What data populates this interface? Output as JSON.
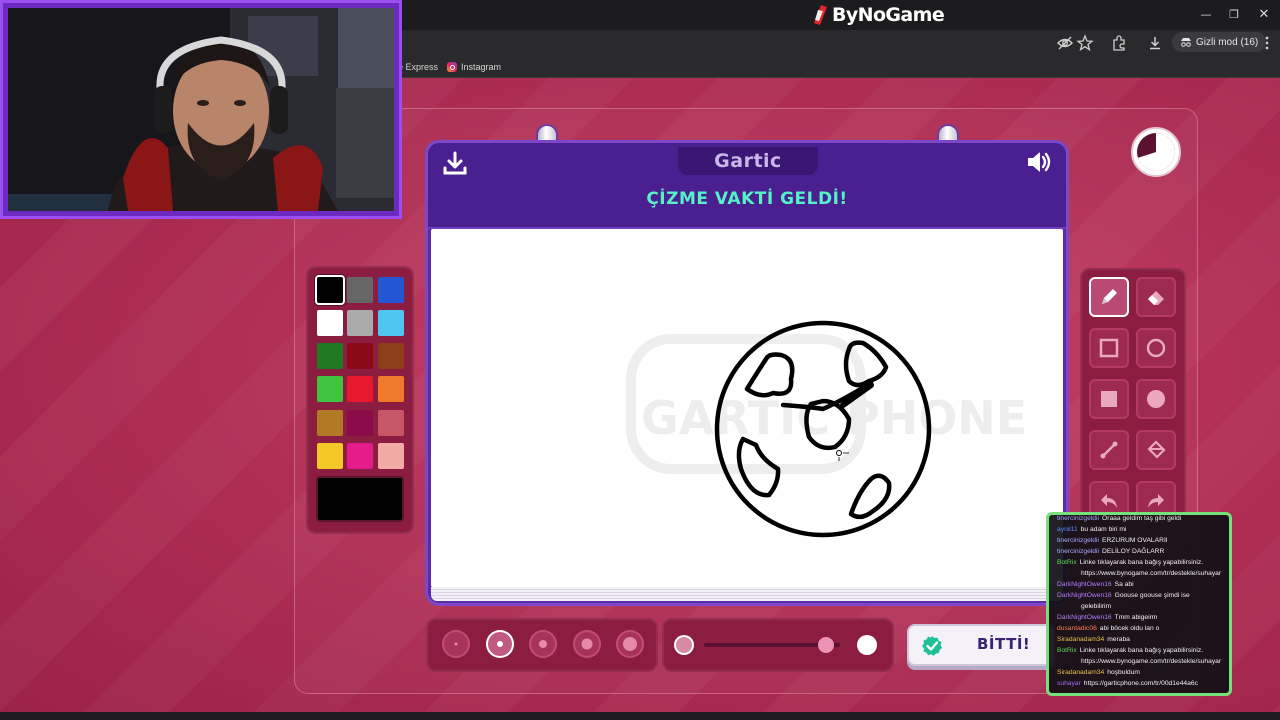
{
  "browser": {
    "brand": "ByNoGame",
    "incognito_label": "Gizli mod (16)",
    "bookmarks": [
      {
        "label": "e Express"
      },
      {
        "label": "Instagram"
      }
    ],
    "window_controls": [
      "minimize-icon",
      "restore-icon",
      "close-icon"
    ]
  },
  "game": {
    "logo": "Gartic",
    "headline": "ÇİZME VAKTİ GELDİ!",
    "done_label": "BİTTİ!",
    "watermark": "GARTIC PHONE",
    "timer_remaining_fraction": 0.7,
    "colors": [
      "#000000",
      "#666666",
      "#2457d6",
      "#ffffff",
      "#aaaaaa",
      "#4fc6f2",
      "#1f7a22",
      "#8a0a1a",
      "#8c3f16",
      "#3ec43e",
      "#e8192c",
      "#ef7a2c",
      "#b27a24",
      "#8a0a4a",
      "#c65767",
      "#f5c82a",
      "#e41c8a",
      "#f2aaa4"
    ],
    "selected_color": "#000000",
    "tools": [
      "pencil-icon",
      "eraser-icon",
      "rectangle-outline-icon",
      "ellipse-outline-icon",
      "rectangle-filled-icon",
      "ellipse-filled-icon",
      "line-icon",
      "fill-bucket-icon",
      "undo-icon",
      "redo-icon"
    ],
    "selected_tool": "pencil-icon",
    "brush_sizes": [
      1,
      2,
      3,
      4,
      5
    ],
    "selected_brush_size": 2,
    "opacity_level": 0.9
  },
  "chat": {
    "accent": "#78e07a",
    "messages": [
      {
        "user": "tinercinizgeldii",
        "user_color": "#a8a8ff",
        "text": "Oraaa geldim taş gibi geldi"
      },
      {
        "user": "aynil11",
        "user_color": "#5a8dff",
        "text": "bu adam biri mi"
      },
      {
        "user": "tinercinizgeldii",
        "user_color": "#a8a8ff",
        "text": "ERZURUM OVALARII"
      },
      {
        "user": "tinercinizgeldii",
        "user_color": "#a8a8ff",
        "text": "DELİLOY DAĞLARR"
      },
      {
        "user": "BotRix",
        "user_color": "#57d957",
        "text": "Linke tıklayarak bana bağış yapabilirsiniz."
      },
      {
        "user": "",
        "user_color": "#ffffff",
        "text": "https://www.bynogame.com/tr/destekle/suhayar"
      },
      {
        "user": "DarkNightOwen16",
        "user_color": "#b57cff",
        "text": "Sa abi"
      },
      {
        "user": "DarkNightOwen16",
        "user_color": "#b57cff",
        "text": "Goouse goouse şimdi ise"
      },
      {
        "user": "",
        "user_color": "#ffffff",
        "text": "gelebilirim"
      },
      {
        "user": "DarkNightOwen16",
        "user_color": "#b57cff",
        "text": "Tmm abigeirm"
      },
      {
        "user": "dusantadic06",
        "user_color": "#ff7f50",
        "text": "abi böcek oldu lan o"
      },
      {
        "user": "Siradanadam34",
        "user_color": "#e8c04a",
        "text": "meraba"
      },
      {
        "user": "BotRix",
        "user_color": "#57d957",
        "text": "Linke tıklayarak bana bağış yapabilirsiniz."
      },
      {
        "user": "",
        "user_color": "#ffffff",
        "text": "https://www.bynogame.com/tr/destekle/suhayar"
      },
      {
        "user": "Siradanadam34",
        "user_color": "#e8c04a",
        "text": "hoşbuldum"
      },
      {
        "user": "suhayar",
        "user_color": "#a36bff",
        "text": "https://garticphone.com/tr/00d1e44a6c"
      }
    ]
  }
}
